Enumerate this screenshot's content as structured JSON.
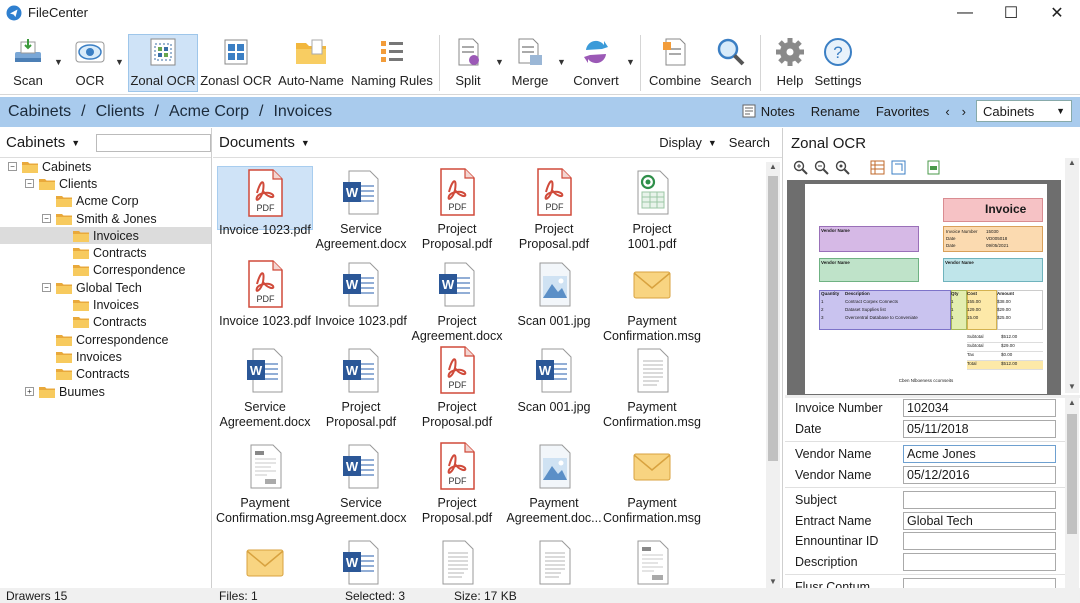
{
  "app": {
    "title": "FileCenter"
  },
  "window_controls": {
    "minimize": "—",
    "maximize": "☐",
    "close": "✕"
  },
  "ribbon": [
    {
      "label": "Scan",
      "icon": "scanner-icon"
    },
    {
      "label": "OCR",
      "icon": "eye-icon"
    },
    {
      "label": "Zonal OCR",
      "icon": "zonal-ocr-icon"
    },
    {
      "label": "Zonasl OCR",
      "icon": "grid-icon"
    },
    {
      "label": "Auto-Name",
      "icon": "folder-icon"
    },
    {
      "label": "Naming Rules",
      "icon": "checklist-icon"
    },
    {
      "label": "Split",
      "icon": "split-icon"
    },
    {
      "label": "Merge",
      "icon": "merge-icon"
    },
    {
      "label": "Convert",
      "icon": "convert-icon"
    },
    {
      "label": "Combine",
      "icon": "combine-icon"
    },
    {
      "label": "Search",
      "icon": "search-icon"
    },
    {
      "label": "Help",
      "icon": "gear-icon"
    },
    {
      "label": "Settings",
      "icon": "help-icon"
    }
  ],
  "breadcrumb": [
    "Cabinets",
    "Clients",
    "Acme Corp",
    "Invoices"
  ],
  "crumb_tools": {
    "notes": "Notes",
    "rename": "Rename",
    "favorites": "Favorites",
    "cabinet_select": "Cabinets"
  },
  "left": {
    "header": "Cabinets",
    "tree": [
      {
        "label": "Cabinets",
        "depth": 0,
        "exp": "-"
      },
      {
        "label": "Clients",
        "depth": 1,
        "exp": "-"
      },
      {
        "label": "Acme Corp",
        "depth": 2,
        "exp": ""
      },
      {
        "label": "Smith & Jones",
        "depth": 2,
        "exp": "-"
      },
      {
        "label": "Invoices",
        "depth": 3,
        "exp": "",
        "selected": true
      },
      {
        "label": "Contracts",
        "depth": 3,
        "exp": ""
      },
      {
        "label": "Correspondence",
        "depth": 3,
        "exp": ""
      },
      {
        "label": "Global Tech",
        "depth": 2,
        "exp": "-"
      },
      {
        "label": "Invoices",
        "depth": 3,
        "exp": ""
      },
      {
        "label": "Contracts",
        "depth": 3,
        "exp": ""
      },
      {
        "label": "Correspondence",
        "depth": 2,
        "exp": ""
      },
      {
        "label": "Invoices",
        "depth": 2,
        "exp": ""
      },
      {
        "label": "Contracts",
        "depth": 2,
        "exp": ""
      },
      {
        "label": "Buumes",
        "depth": 1,
        "exp": "+"
      }
    ]
  },
  "center": {
    "header": "Documents",
    "display": "Display",
    "search": "Search",
    "docs": [
      {
        "name": [
          "Invoice 1023.pdf"
        ],
        "type": "pdf",
        "selected": true
      },
      {
        "name": [
          "Service",
          "Agreement.docx"
        ],
        "type": "word"
      },
      {
        "name": [
          "Project",
          "Proposal.pdf"
        ],
        "type": "pdf"
      },
      {
        "name": [
          "Project",
          "Proposal.pdf"
        ],
        "type": "pdf"
      },
      {
        "name": [
          "Project",
          "1001.pdf"
        ],
        "type": "sheet"
      },
      {
        "name": [
          "Invoice 1023.pdf"
        ],
        "type": "pdf"
      },
      {
        "name": [
          "Invoice 1023.pdf"
        ],
        "type": "word"
      },
      {
        "name": [
          "Project",
          "Agreement.docx"
        ],
        "type": "word"
      },
      {
        "name": [
          "Scan 001.jpg"
        ],
        "type": "image"
      },
      {
        "name": [
          "Payment",
          "Confirmation.msg"
        ],
        "type": "mail"
      },
      {
        "name": [
          "Service",
          "Agreement.docx"
        ],
        "type": "word"
      },
      {
        "name": [
          "Project",
          "Proposal.pdf"
        ],
        "type": "word"
      },
      {
        "name": [
          "Project",
          "Proposal.pdf"
        ],
        "type": "pdf"
      },
      {
        "name": [
          "Scan 001.jpg"
        ],
        "type": "word"
      },
      {
        "name": [
          "Payment",
          "Confirmation.msg"
        ],
        "type": "text"
      },
      {
        "name": [
          "Payment",
          "Confirmation.msg"
        ],
        "type": "scan"
      },
      {
        "name": [
          "Service",
          "Agreement.docx"
        ],
        "type": "word"
      },
      {
        "name": [
          "Project",
          "Proposal.pdf"
        ],
        "type": "pdf"
      },
      {
        "name": [
          "Payment",
          "Agreement.doc..."
        ],
        "type": "image"
      },
      {
        "name": [
          "Payment",
          "Confirmation.msg"
        ],
        "type": "mail"
      },
      {
        "name": [
          ""
        ],
        "type": "mail"
      },
      {
        "name": [
          ""
        ],
        "type": "word"
      },
      {
        "name": [
          ""
        ],
        "type": "text"
      },
      {
        "name": [
          ""
        ],
        "type": "text"
      },
      {
        "name": [
          ""
        ],
        "type": "scan"
      }
    ]
  },
  "right": {
    "header": "Zonal OCR",
    "invoice_preview": {
      "title": "Invoice",
      "footer": "Cben Nlboeness ccomseits",
      "box1_title": "Vendor Name",
      "box2_title": "Vendor Name",
      "box3_title": "Vendor Name",
      "hdr": [
        "Quantity",
        "Description",
        "Qty",
        "Cost",
        "Amount"
      ],
      "rows": [
        [
          "1",
          "Contract Corpex Connects",
          "1",
          "155.00",
          "$38.00"
        ],
        [
          "2",
          "Dataset Supplies list",
          "1",
          "129.00",
          "$29.00"
        ],
        [
          "3",
          "Overcentral Database to Conveniate",
          "1",
          "15.00",
          "$25.00"
        ]
      ],
      "totals": [
        [
          "Subtotal",
          "$512.00"
        ],
        [
          "Subtotal",
          "$29.00"
        ],
        [
          "Tax",
          "$0.00"
        ],
        [
          "Total",
          "$512.00"
        ]
      ],
      "meta": [
        [
          "Invoice Number",
          "15030"
        ],
        [
          "Date",
          "VD005018"
        ],
        [
          "Date",
          "09/05/2021"
        ]
      ]
    },
    "fields": [
      {
        "label": "Invoice Number",
        "value": "102034"
      },
      {
        "label": "Date",
        "value": "05/11/2018"
      },
      {
        "label": "Vendor Name",
        "value": "Acme Jones",
        "focus": true
      },
      {
        "label": "Vendor Name",
        "value": "05/12/2016"
      },
      {
        "label": "Subject",
        "value": ""
      },
      {
        "label": "Entract Name",
        "value": "Global Tech"
      },
      {
        "label": "Ennountinar ID",
        "value": ""
      },
      {
        "label": "Description",
        "value": ""
      },
      {
        "label": "Flusr Contum",
        "value": ""
      }
    ]
  },
  "status": {
    "drawers": "Drawers 15",
    "files": "Files: 1",
    "selected": "Selected: 3",
    "size": "Size: 17 KB"
  }
}
